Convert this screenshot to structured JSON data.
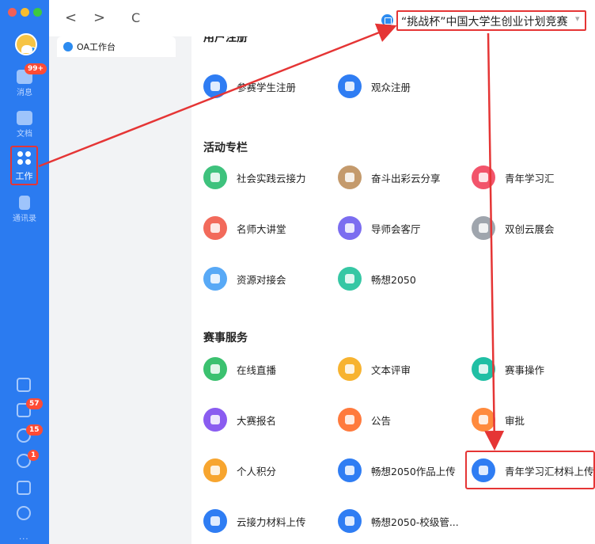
{
  "sidebar": {
    "nav": [
      {
        "key": "messages",
        "label": "消息",
        "badge": "99+"
      },
      {
        "key": "docs",
        "label": "文档"
      },
      {
        "key": "work",
        "label": "工作"
      },
      {
        "key": "contacts",
        "label": "通讯录"
      }
    ],
    "bottom_badges": {
      "todo": "57",
      "lightning": "15",
      "phone": "1"
    },
    "more": "···"
  },
  "topbar": {
    "back": "<",
    "forward": ">",
    "refresh": "C",
    "title": "“挑战杯”中国大学生创业计划竞赛",
    "caret": "▾"
  },
  "tab": {
    "label": "OA工作台"
  },
  "sections": [
    {
      "title": "用户注册",
      "items": [
        {
          "label": "参赛学生注册",
          "color": "#2f7df3",
          "icon": "student-icon"
        },
        {
          "label": "观众注册",
          "color": "#2f7df3",
          "icon": "audience-icon"
        }
      ]
    },
    {
      "title": "活动专栏",
      "items": [
        {
          "label": "社会实践云接力",
          "color": "#3ec27d",
          "icon": "relay-icon"
        },
        {
          "label": "奋斗出彩云分享",
          "color": "#c49a6c",
          "icon": "share-icon"
        },
        {
          "label": "青年学习汇",
          "color": "#f2546b",
          "icon": "study-icon"
        },
        {
          "label": "名师大讲堂",
          "color": "#f26a5b",
          "icon": "lecture-icon"
        },
        {
          "label": "导师会客厅",
          "color": "#7b6df0",
          "icon": "mentor-icon"
        },
        {
          "label": "双创云展会",
          "color": "#9fa5ad",
          "icon": "expo-icon"
        },
        {
          "label": "资源对接会",
          "color": "#58a9f6",
          "icon": "resource-icon"
        },
        {
          "label": "畅想2050",
          "color": "#36c7a4",
          "icon": "future-icon"
        }
      ]
    },
    {
      "title": "赛事服务",
      "items": [
        {
          "label": "在线直播",
          "color": "#3bc16f",
          "icon": "live-icon"
        },
        {
          "label": "文本评审",
          "color": "#f7b330",
          "icon": "review-icon"
        },
        {
          "label": "赛事操作",
          "color": "#20bfa4",
          "icon": "gear-icon"
        },
        {
          "label": "大赛报名",
          "color": "#8a5cf0",
          "icon": "signup-icon"
        },
        {
          "label": "公告",
          "color": "#ff7a3d",
          "icon": "megaphone-icon"
        },
        {
          "label": "审批",
          "color": "#ff8a3d",
          "icon": "approve-icon"
        },
        {
          "label": "个人积分",
          "color": "#f7a52f",
          "icon": "points-icon"
        },
        {
          "label": "畅想2050作品上传",
          "color": "#2f7df3",
          "icon": "upload-icon"
        },
        {
          "label": "青年学习汇材料上传",
          "color": "#2f7df3",
          "icon": "upload-icon"
        },
        {
          "label": "云接力材料上传",
          "color": "#2f7df3",
          "icon": "upload-icon"
        },
        {
          "label": "畅想2050-校级管...",
          "color": "#2f7df3",
          "icon": "upload-icon"
        }
      ]
    }
  ]
}
